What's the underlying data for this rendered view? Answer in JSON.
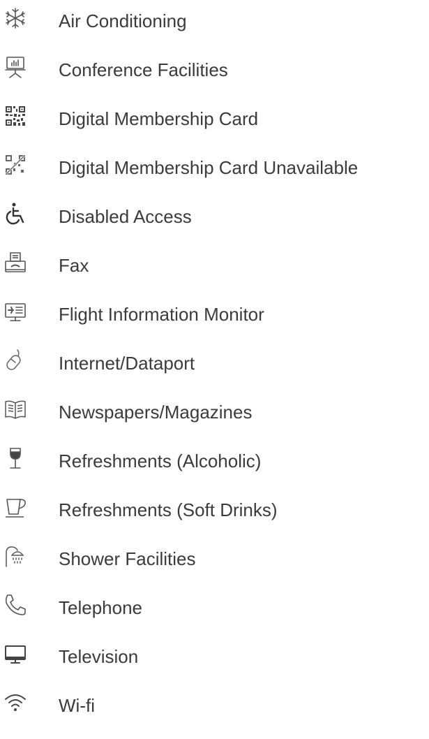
{
  "amenities": [
    {
      "icon": "snowflake-icon",
      "label": "Air Conditioning"
    },
    {
      "icon": "presentation-board-icon",
      "label": "Conference Facilities"
    },
    {
      "icon": "qr-code-icon",
      "label": "Digital Membership Card"
    },
    {
      "icon": "qr-code-unavailable-icon",
      "label": "Digital Membership Card Unavailable"
    },
    {
      "icon": "wheelchair-icon",
      "label": "Disabled Access"
    },
    {
      "icon": "fax-machine-icon",
      "label": "Fax"
    },
    {
      "icon": "flight-monitor-icon",
      "label": "Flight Information Monitor"
    },
    {
      "icon": "mouse-icon",
      "label": "Internet/Dataport"
    },
    {
      "icon": "open-book-icon",
      "label": "Newspapers/Magazines"
    },
    {
      "icon": "wine-glass-icon",
      "label": "Refreshments (Alcoholic)"
    },
    {
      "icon": "cup-icon",
      "label": "Refreshments (Soft Drinks)"
    },
    {
      "icon": "shower-icon",
      "label": "Shower Facilities"
    },
    {
      "icon": "telephone-icon",
      "label": "Telephone"
    },
    {
      "icon": "television-icon",
      "label": "Television"
    },
    {
      "icon": "wifi-icon",
      "label": "Wi-fi"
    }
  ]
}
